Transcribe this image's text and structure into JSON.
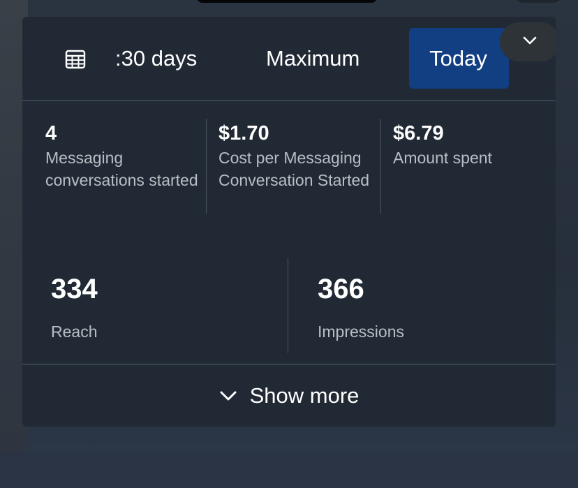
{
  "date_picker": {
    "range_label": ":30 days",
    "maximum_label": "Maximum",
    "today_label": "Today",
    "calendar_icon": "calendar-icon",
    "expand_icon": "chevron-down-icon",
    "selected": "Today"
  },
  "metrics_top": [
    {
      "value": "4",
      "label": "Messaging conversations started"
    },
    {
      "value": "$1.70",
      "label": "Cost per Messaging Conversation Started"
    },
    {
      "value": "$6.79",
      "label": "Amount spent"
    }
  ],
  "metrics_bottom": [
    {
      "value": "334",
      "label": "Reach"
    },
    {
      "value": "366",
      "label": "Impressions"
    }
  ],
  "footer": {
    "show_more_label": "Show more",
    "show_more_icon": "chevron-down-icon"
  },
  "colors": {
    "card_bg": "#212a34",
    "selected_bg": "#123e82",
    "text_primary": "#ffffff",
    "text_secondary": "#b9bec5"
  }
}
